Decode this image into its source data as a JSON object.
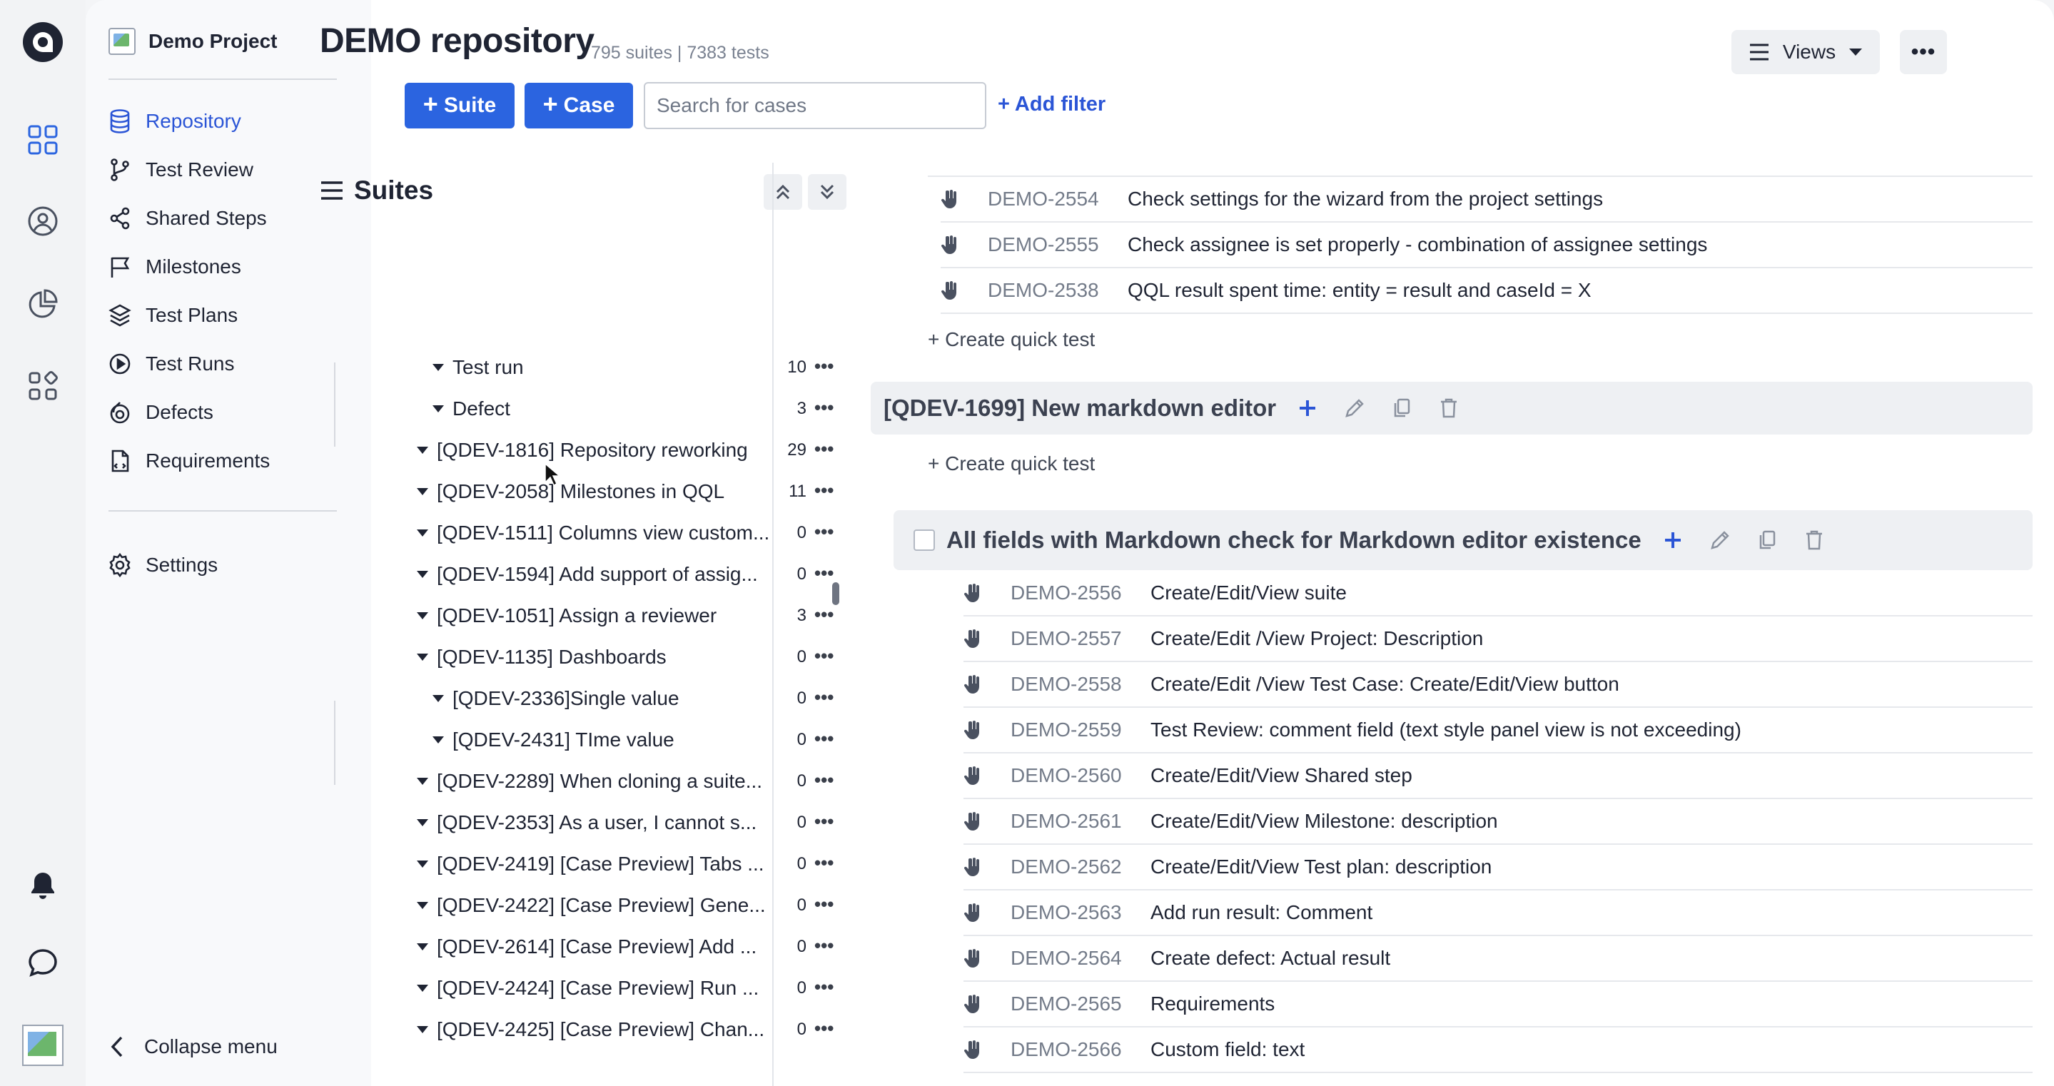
{
  "project": {
    "name": "Demo Project"
  },
  "nav": {
    "items": [
      {
        "label": "Repository",
        "icon": "database-icon",
        "active": true
      },
      {
        "label": "Test Review",
        "icon": "git-branch-icon"
      },
      {
        "label": "Shared Steps",
        "icon": "share-icon"
      },
      {
        "label": "Milestones",
        "icon": "flag-icon"
      },
      {
        "label": "Test Plans",
        "icon": "layers-icon"
      },
      {
        "label": "Test Runs",
        "icon": "play-circle-icon"
      },
      {
        "label": "Defects",
        "icon": "bug-icon"
      },
      {
        "label": "Requirements",
        "icon": "document-icon"
      }
    ],
    "settings": "Settings",
    "collapse": "Collapse menu"
  },
  "header": {
    "title": "DEMO repository",
    "stats": "795 suites | 7383 tests",
    "suite_button": "Suite",
    "case_button": "Case",
    "search_placeholder": "Search for cases",
    "add_filter": "+ Add filter",
    "views": "Views"
  },
  "suites_panel": {
    "title": "Suites",
    "tree": [
      {
        "label": "Test run",
        "count": "10",
        "indent": 1
      },
      {
        "label": "Defect",
        "count": "3",
        "indent": 1
      },
      {
        "label": "[QDEV-1816] Repository reworking",
        "count": "29",
        "indent": 0
      },
      {
        "label": "[QDEV-2058] Milestones in QQL",
        "count": "11",
        "indent": 0
      },
      {
        "label": "[QDEV-1511] Columns view custom...",
        "count": "0",
        "indent": 0
      },
      {
        "label": "[QDEV-1594] Add support of assig...",
        "count": "0",
        "indent": 0
      },
      {
        "label": "[QDEV-1051] Assign a reviewer",
        "count": "3",
        "indent": 0
      },
      {
        "label": "[QDEV-1135] Dashboards",
        "count": "0",
        "indent": 0
      },
      {
        "label": "[QDEV-2336]Single value",
        "count": "0",
        "indent": 1
      },
      {
        "label": "[QDEV-2431] TIme value",
        "count": "0",
        "indent": 1
      },
      {
        "label": "[QDEV-2289] When cloning a suite...",
        "count": "0",
        "indent": 0
      },
      {
        "label": "[QDEV-2353] As a user, I cannot s...",
        "count": "0",
        "indent": 0
      },
      {
        "label": "[QDEV-2419] [Case Preview] Tabs ...",
        "count": "0",
        "indent": 0
      },
      {
        "label": "[QDEV-2422] [Case Preview] Gene...",
        "count": "0",
        "indent": 0
      },
      {
        "label": "[QDEV-2614] [Case Preview] Add ...",
        "count": "0",
        "indent": 0
      },
      {
        "label": "[QDEV-2424] [Case Preview] Run ...",
        "count": "0",
        "indent": 0
      },
      {
        "label": "[QDEV-2425] [Case Preview] Chan...",
        "count": "0",
        "indent": 0
      }
    ]
  },
  "cases": {
    "top_group": [
      {
        "id": "DEMO-2554",
        "title": "Check settings for the wizard from the project settings"
      },
      {
        "id": "DEMO-2555",
        "title": "Check assignee is set properly - combination of assignee settings"
      },
      {
        "id": "DEMO-2538",
        "title": "QQL result spent time: entity = result and caseId = X"
      }
    ],
    "create_quick": "+ Create quick test",
    "suite1_title": "[QDEV-1699] New markdown editor",
    "suite2_title": "All fields with Markdown check for Markdown editor existence",
    "suite2_cases": [
      {
        "id": "DEMO-2556",
        "title": "Create/Edit/View suite"
      },
      {
        "id": "DEMO-2557",
        "title": "Create/Edit /View Project: Description"
      },
      {
        "id": "DEMO-2558",
        "title": "Create/Edit /View Test Case: Create/Edit/View button"
      },
      {
        "id": "DEMO-2559",
        "title": "Test Review: comment field (text style panel view is not exceeding)"
      },
      {
        "id": "DEMO-2560",
        "title": "Create/Edit/View Shared step"
      },
      {
        "id": "DEMO-2561",
        "title": "Create/Edit/View Milestone: description"
      },
      {
        "id": "DEMO-2562",
        "title": "Create/Edit/View Test plan: description"
      },
      {
        "id": "DEMO-2563",
        "title": "Add run result: Comment"
      },
      {
        "id": "DEMO-2564",
        "title": "Create defect: Actual result"
      },
      {
        "id": "DEMO-2565",
        "title": "Requirements"
      },
      {
        "id": "DEMO-2566",
        "title": "Custom field: text"
      }
    ]
  },
  "colors": {
    "accent": "#2b64e0",
    "link": "#2b55d6",
    "text": "#1f2433",
    "muted": "#737b89"
  }
}
